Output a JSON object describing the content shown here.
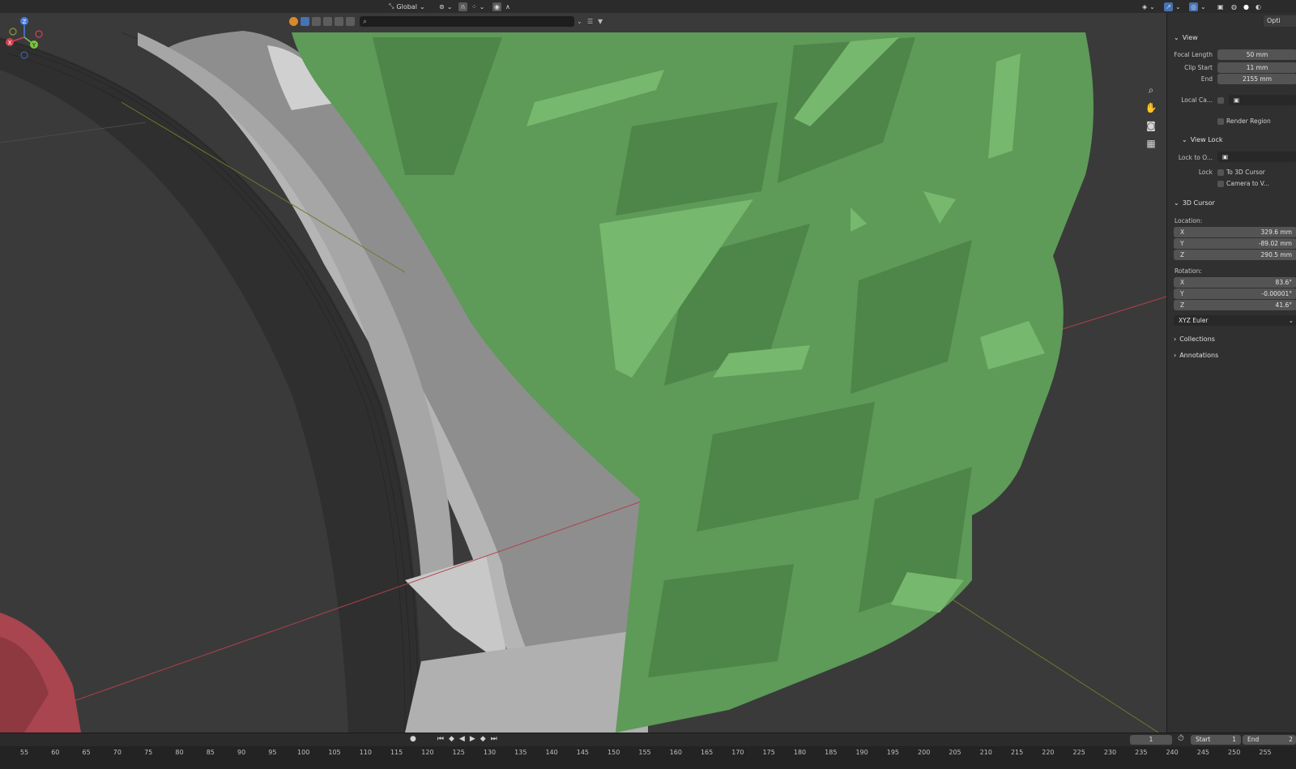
{
  "header": {
    "orientation_label": "Global",
    "right_tab": "Opti"
  },
  "toolbar": {
    "search_placeholder": ""
  },
  "npanel": {
    "view": {
      "title": "View",
      "focal_length_label": "Focal Length",
      "focal_length": "50 mm",
      "clip_start_label": "Clip Start",
      "clip_start": "11 mm",
      "clip_end_label": "End",
      "clip_end": "2155 mm",
      "local_camera_label": "Local Ca...",
      "render_region_label": "Render Region"
    },
    "view_lock": {
      "title": "View Lock",
      "lock_to_object_label": "Lock to O...",
      "lock_label": "Lock",
      "to_3d_cursor_label": "To 3D Cursor",
      "camera_to_view_label": "Camera to V..."
    },
    "cursor": {
      "title": "3D Cursor",
      "location_label": "Location:",
      "loc_x": "329.6 mm",
      "loc_y": "-89.02 mm",
      "loc_z": "290.5 mm",
      "rotation_label": "Rotation:",
      "rot_x": "83.6°",
      "rot_y": "-0.00001°",
      "rot_z": "41.6°",
      "rotation_mode": "XYZ Euler"
    },
    "collections_label": "Collections",
    "annotations_label": "Annotations"
  },
  "axis_labels": {
    "x": "X",
    "y": "Y",
    "z": "Z"
  },
  "timeline": {
    "current_frame": "1",
    "start_label": "Start",
    "start_value": "1",
    "end_label": "End",
    "end_value": "2",
    "ticks": [
      "55",
      "60",
      "65",
      "70",
      "75",
      "80",
      "85",
      "90",
      "95",
      "100",
      "105",
      "110",
      "115",
      "120",
      "125",
      "130",
      "135",
      "140",
      "145",
      "150",
      "155",
      "160",
      "165",
      "170",
      "175",
      "180",
      "185",
      "190",
      "195",
      "200",
      "205",
      "210",
      "215",
      "220",
      "225",
      "230",
      "235",
      "240",
      "245",
      "250",
      "255"
    ]
  },
  "colors": {
    "green_mesh": "#5e9a58",
    "red_mesh": "#a8454e",
    "grey_part": "#9a9a9a",
    "viewport_bg": "#3a3a3a"
  }
}
